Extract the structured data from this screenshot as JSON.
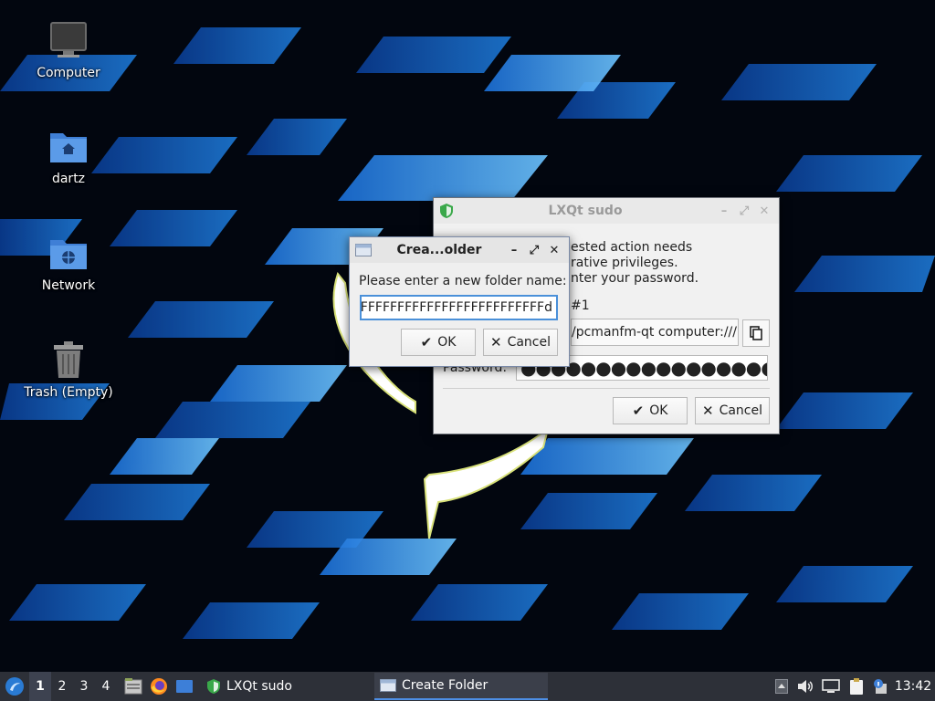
{
  "desktop": {
    "icons": [
      {
        "label": "Computer",
        "icon": "computer-icon"
      },
      {
        "label": "dartz",
        "icon": "home-folder-icon"
      },
      {
        "label": "Network",
        "icon": "network-folder-icon"
      },
      {
        "label": "Trash (Empty)",
        "icon": "trash-icon"
      }
    ]
  },
  "sudo_dialog": {
    "title": "LXQt sudo",
    "message_lines": [
      "ested action needs",
      "rative privileges.",
      "nter your password."
    ],
    "user_suffix": "#1",
    "command": "/pcmanfm-qt computer:///",
    "password_label": "Password:",
    "password_value": "●●●●●●●●●●●●●●●●●●●●●",
    "ok_label": "OK",
    "cancel_label": "Cancel"
  },
  "create_folder_dialog": {
    "title": "Crea...older",
    "prompt": "Please enter a new folder name:",
    "input_value": "FFFFFFFFFFFFFFFFFFFFFFFFFFd",
    "ok_label": "OK",
    "cancel_label": "Cancel"
  },
  "taskbar": {
    "workspaces": [
      "1",
      "2",
      "3",
      "4"
    ],
    "active_workspace": "1",
    "tasks": [
      {
        "label": "LXQt sudo",
        "icon": "shield-icon"
      },
      {
        "label": "Create Folder",
        "icon": "window-icon"
      }
    ],
    "clock": "13:42"
  },
  "colors": {
    "accent": "#4a90d9",
    "taskbar_bg": "#2d3038"
  }
}
